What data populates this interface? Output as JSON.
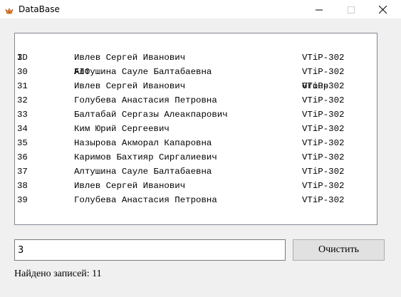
{
  "window": {
    "title": "DataBase"
  },
  "list": {
    "header": {
      "id": "ID",
      "fio": "FIO",
      "group": "Group"
    },
    "rows": [
      {
        "id": "3",
        "fio": "Ивлев Сергей Иванович",
        "group": "VTiP-302"
      },
      {
        "id": "30",
        "fio": "Алтушина Сауле Балтабаевна",
        "group": "VTiP-302"
      },
      {
        "id": "31",
        "fio": "Ивлев Сергей Иванович",
        "group": "VTiP-302"
      },
      {
        "id": "32",
        "fio": "Голубева Анастасия Петровна",
        "group": "VTiP-302"
      },
      {
        "id": "33",
        "fio": "Балтабай Сергазы Алеакпарович",
        "group": "VTiP-302"
      },
      {
        "id": "34",
        "fio": "Ким Юрий Сергеевич",
        "group": "VTiP-302"
      },
      {
        "id": "35",
        "fio": "Назырова Акморал Капаровна",
        "group": "VTiP-302"
      },
      {
        "id": "36",
        "fio": "Каримов Бахтияр Сиргалиевич",
        "group": "VTiP-302"
      },
      {
        "id": "37",
        "fio": "Алтушина Сауле Балтабаевна",
        "group": "VTiP-302"
      },
      {
        "id": "38",
        "fio": "Ивлев Сергей Иванович",
        "group": "VTiP-302"
      },
      {
        "id": "39",
        "fio": "Голубева Анастасия Петровна",
        "group": "VTiP-302"
      }
    ]
  },
  "search": {
    "value": "3"
  },
  "clear_button": {
    "label": "Очистить"
  },
  "status": {
    "text": "Найдено записей: 11"
  }
}
